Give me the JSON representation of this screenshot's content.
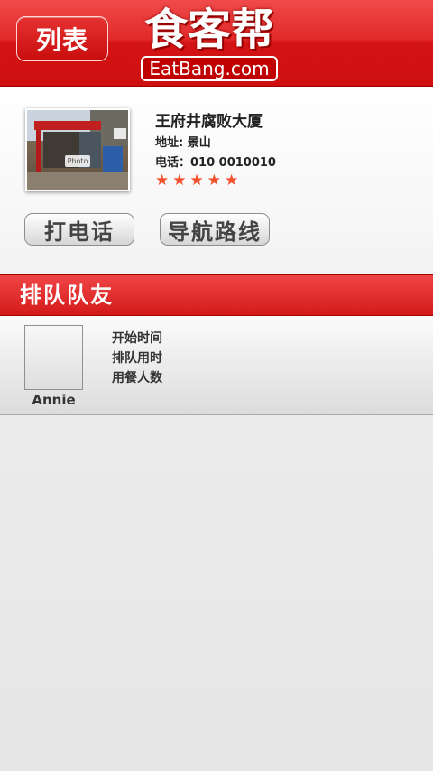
{
  "header": {
    "back_label": "列表",
    "logo_cn": "食客帮",
    "logo_en": "EatBang.com"
  },
  "restaurant": {
    "photo_tag": "Photo",
    "name": "王府井腐败大厦",
    "address": "地址: 景山",
    "phone": "电话：010 0010010",
    "rating": 5,
    "rating_max": 5,
    "star_color": "#f3502d"
  },
  "actions": {
    "call_label": "打电话",
    "nav_label": "导航路线"
  },
  "section": {
    "title": "排队队友"
  },
  "queue": [
    {
      "name": "Annie",
      "fields": [
        "开始时间",
        "排队用时",
        "用餐人数"
      ]
    }
  ],
  "colors": {
    "brand_red": "#d41414",
    "text_dark": "#222222"
  }
}
